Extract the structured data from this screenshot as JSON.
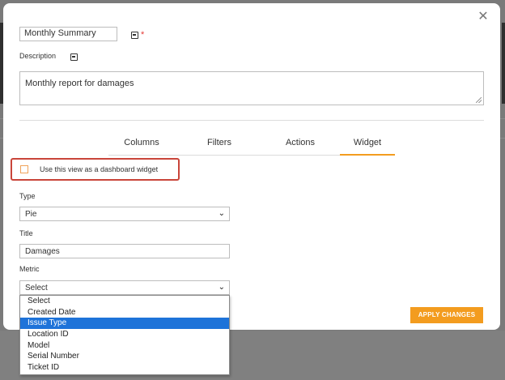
{
  "form": {
    "name_value": "Monthly Summary",
    "required_marker": "*",
    "description_label": "Description",
    "description_value": "Monthly report for damages"
  },
  "tabs": [
    {
      "label": "Columns"
    },
    {
      "label": "Filters"
    },
    {
      "label": "Actions"
    },
    {
      "label": "Widget",
      "active": true
    }
  ],
  "widget": {
    "checkbox_label": "Use this view as a dashboard widget",
    "checkbox_checked": false,
    "type_label": "Type",
    "type_value": "Pie",
    "title_label": "Title",
    "title_value": "Damages",
    "metric_label": "Metric",
    "metric_value": "Select",
    "metric_options": [
      "Select",
      "Created Date",
      "Issue Type",
      "Location ID",
      "Model",
      "Serial Number",
      "Ticket ID"
    ],
    "metric_highlighted": "Issue Type"
  },
  "actions": {
    "apply_label": "APPLY CHANGES"
  },
  "colors": {
    "accent": "#f39c1f",
    "highlight": "#1e73d9",
    "emphasis_border": "#c9453a"
  }
}
